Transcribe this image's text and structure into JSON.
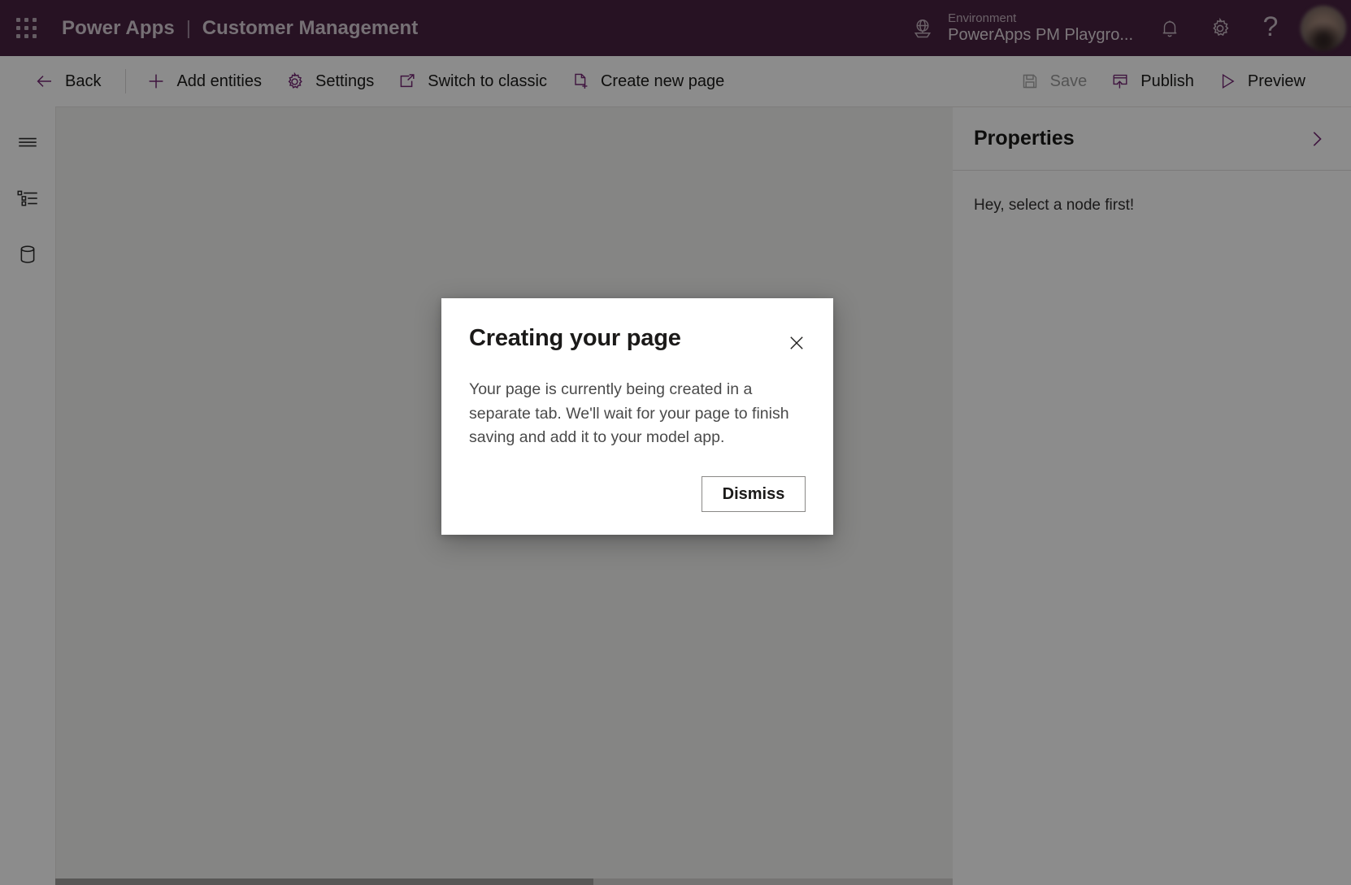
{
  "header": {
    "waffle_icon": "app-launcher-icon",
    "product": "Power Apps",
    "separator": "|",
    "app_name": "Customer Management",
    "environment_label": "Environment",
    "environment_value": "PowerApps PM Playgro...",
    "globe_icon": "globe-icon",
    "notification_icon": "bell-icon",
    "settings_icon": "gear-icon",
    "help_icon": "question-mark-icon",
    "help_glyph": "?",
    "avatar_icon": "user-avatar",
    "brand_color": "#472140",
    "brand_text_color": "#d8cdd5"
  },
  "toolbar": {
    "left_items": [
      {
        "label": "Back",
        "icon": "arrow-left-icon",
        "disabled": false
      },
      {
        "label": "Add entities",
        "icon": "plus-icon",
        "disabled": false
      },
      {
        "label": "Settings",
        "icon": "gear-icon",
        "disabled": false
      },
      {
        "label": "Switch to classic",
        "icon": "open-in-new-window-icon",
        "disabled": false
      },
      {
        "label": "Create new page",
        "icon": "new-page-icon",
        "disabled": false
      }
    ],
    "right_items": [
      {
        "label": "Save",
        "icon": "save-disk-icon",
        "disabled": true
      },
      {
        "label": "Publish",
        "icon": "publish-icon",
        "disabled": false
      },
      {
        "label": "Preview",
        "icon": "play-triangle-icon",
        "disabled": false
      }
    ],
    "accent_color": "#742774",
    "disabled_color": "#9a9a9a"
  },
  "left_rail": {
    "items": [
      {
        "name": "menu",
        "icon": "hamburger-menu-icon"
      },
      {
        "name": "tree-view",
        "icon": "tree-outline-icon"
      },
      {
        "name": "data",
        "icon": "database-cylinder-icon"
      }
    ]
  },
  "properties_panel": {
    "title": "Properties",
    "collapse_icon": "chevron-right-icon",
    "empty_message": "Hey, select a node first!"
  },
  "canvas": {
    "background_color": "#f3f2f1"
  },
  "dialog": {
    "title": "Creating your page",
    "body": "Your page is currently being created in a separate tab. We'll wait for your page to finish saving and add it to your model app.",
    "close_icon": "close-x-icon",
    "primary_button": "Dismiss"
  }
}
